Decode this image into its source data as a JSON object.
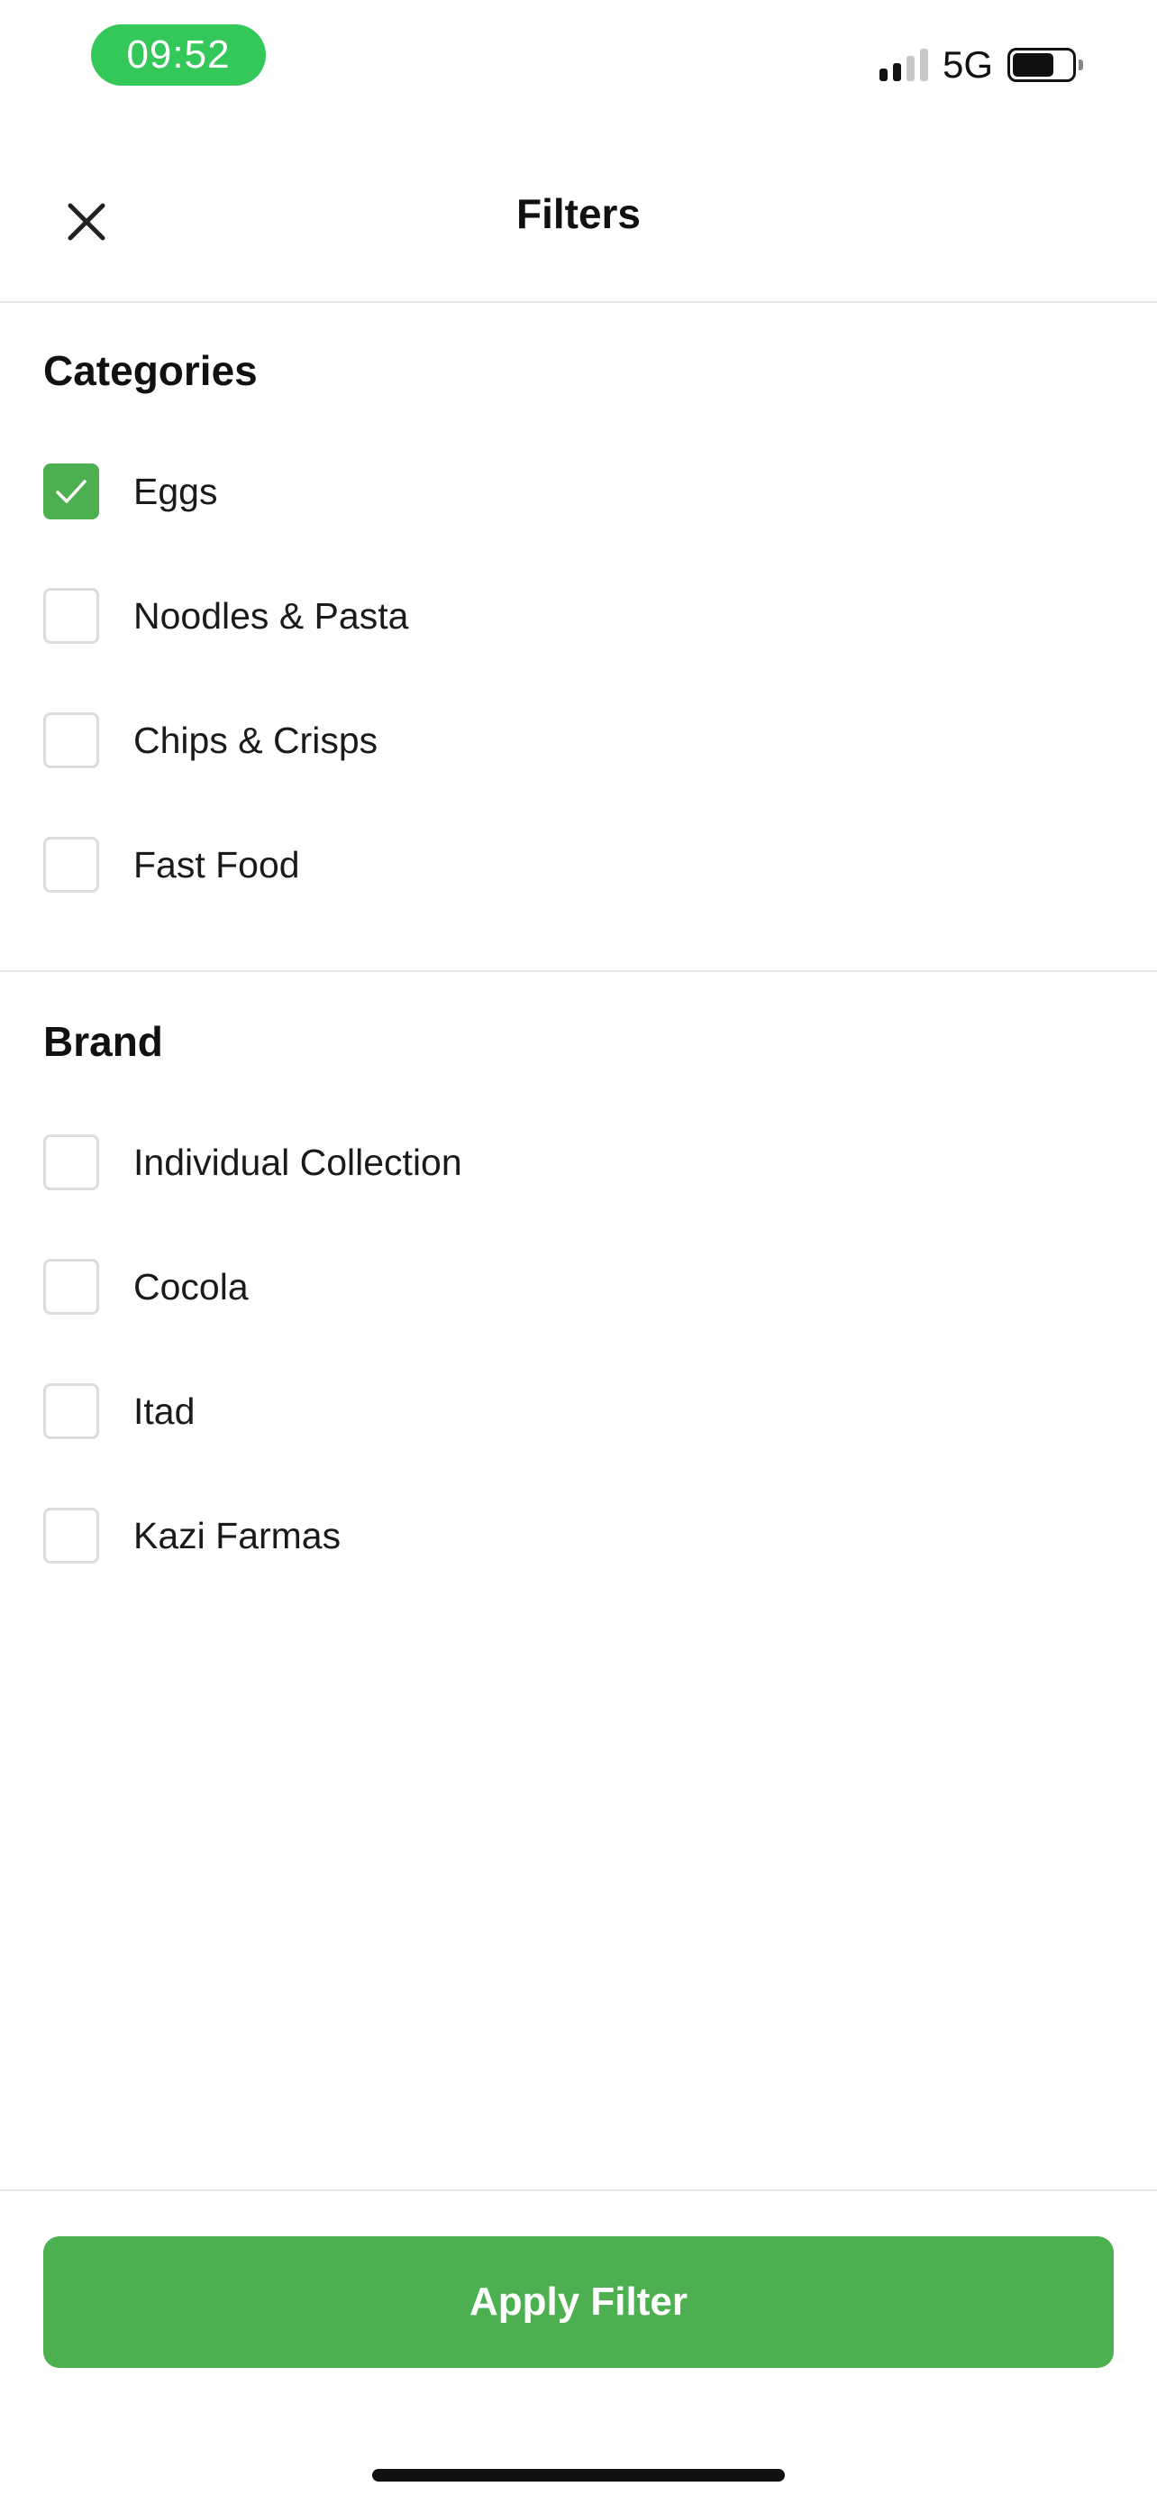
{
  "status_bar": {
    "time": "09:52",
    "network": "5G",
    "accent_color": "#34c759",
    "battery_level": 0.7
  },
  "header": {
    "title": "Filters",
    "close_icon": "close-icon"
  },
  "categories": {
    "title": "Categories",
    "items": [
      {
        "label": "Eggs",
        "checked": true
      },
      {
        "label": "Noodles & Pasta",
        "checked": false
      },
      {
        "label": "Chips & Crisps",
        "checked": false
      },
      {
        "label": "Fast Food",
        "checked": false
      }
    ]
  },
  "brand": {
    "title": "Brand",
    "items": [
      {
        "label": "Individual Collection",
        "checked": false
      },
      {
        "label": "Cocola",
        "checked": false
      },
      {
        "label": "Itad",
        "checked": false
      },
      {
        "label": "Kazi Farmas",
        "checked": false
      }
    ]
  },
  "footer": {
    "apply_label": "Apply Filter",
    "button_color": "#4caf50"
  }
}
